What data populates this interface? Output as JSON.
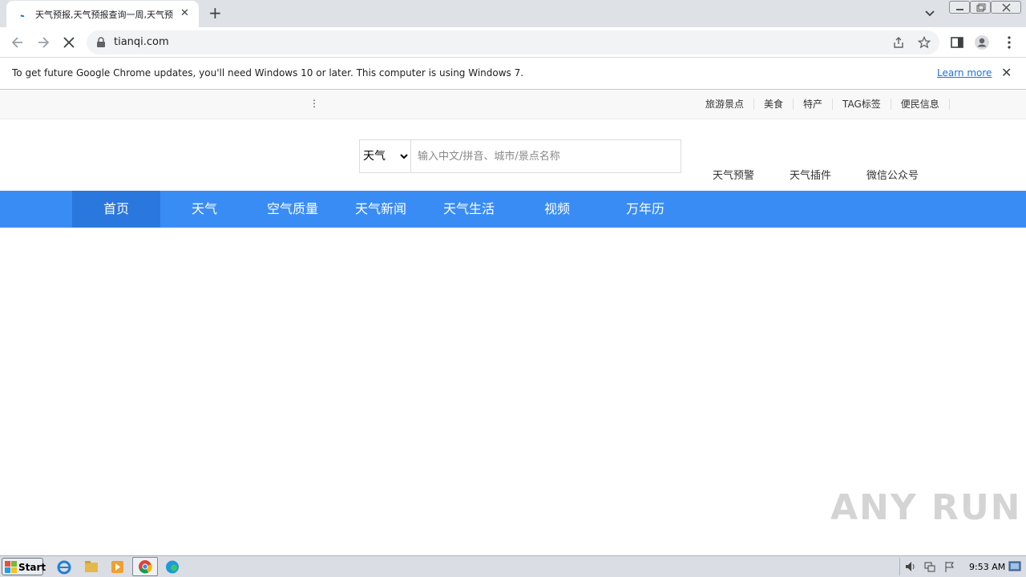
{
  "browser": {
    "tab_title": "天气预报,天气预报查询一周,天气预",
    "tab_close": "✕",
    "new_tab": "+",
    "url": "tianqi.com"
  },
  "infobar": {
    "message": "To get future Google Chrome updates, you'll need Windows 10 or later. This computer is using Windows 7.",
    "learn_more": "Learn more",
    "close": "✕"
  },
  "page": {
    "top_dots": "⋮",
    "top_links": [
      "旅游景点",
      "美食",
      "特产",
      "TAG标签",
      "便民信息"
    ],
    "search": {
      "select_value": "天气",
      "placeholder": "输入中文/拼音、城市/景点名称"
    },
    "side_links": [
      "天气预警",
      "天气插件",
      "微信公众号"
    ],
    "nav": [
      "首页",
      "天气",
      "空气质量",
      "天气新闻",
      "天气生活",
      "视频",
      "万年历"
    ],
    "watermark": "ANY RUN"
  },
  "taskbar": {
    "start": "Start",
    "time": "9:53 AM"
  },
  "colors": {
    "nav_bg": "#3a8cf5",
    "nav_active": "#2a77de",
    "link_blue": "#1a73e8"
  }
}
